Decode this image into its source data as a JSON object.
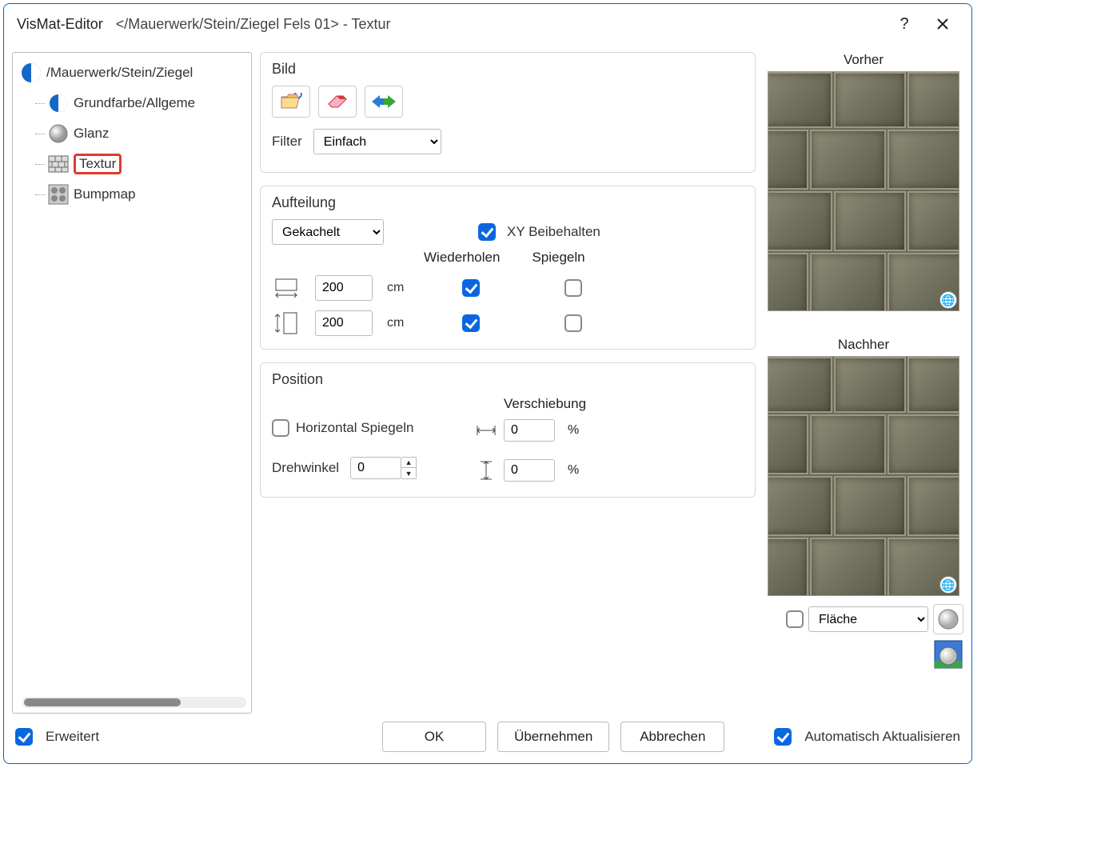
{
  "window": {
    "app_name": "VisMat-Editor",
    "title_path": "</Mauerwerk/Stein/Ziegel Fels 01> - Textur"
  },
  "tree": {
    "root": "/Mauerwerk/Stein/Ziegel",
    "items": [
      {
        "label": "Grundfarbe/Allgeme",
        "icon": "sphere-blue"
      },
      {
        "label": "Glanz",
        "icon": "sphere-grey"
      },
      {
        "label": "Textur",
        "icon": "bricks",
        "selected": true
      },
      {
        "label": "Bumpmap",
        "icon": "dots"
      }
    ]
  },
  "groups": {
    "image": {
      "title": "Bild",
      "filter_label": "Filter",
      "filter_value": "Einfach"
    },
    "tiling": {
      "title": "Aufteilung",
      "mode": "Gekachelt",
      "keep_xy_label": "XY Beibehalten",
      "keep_xy": true,
      "col_repeat": "Wiederholen",
      "col_mirror": "Spiegeln",
      "x_value": "200",
      "y_value": "200",
      "unit": "cm",
      "repeat_x": true,
      "repeat_y": true,
      "mirror_x": false,
      "mirror_y": false
    },
    "position": {
      "title": "Position",
      "shift_title": "Verschiebung",
      "hmirror_label": "Horizontal Spiegeln",
      "hmirror": false,
      "angle_label": "Drehwinkel",
      "angle_value": "0",
      "shift_x": "0",
      "shift_y": "0",
      "percent": "%"
    }
  },
  "preview": {
    "before": "Vorher",
    "after": "Nachher",
    "surface_select": "Fläche",
    "surface_checked": false
  },
  "footer": {
    "advanced_label": "Erweitert",
    "advanced_checked": true,
    "ok": "OK",
    "apply": "Übernehmen",
    "cancel": "Abbrechen",
    "auto_label": "Automatisch Aktualisieren",
    "auto_checked": true
  }
}
